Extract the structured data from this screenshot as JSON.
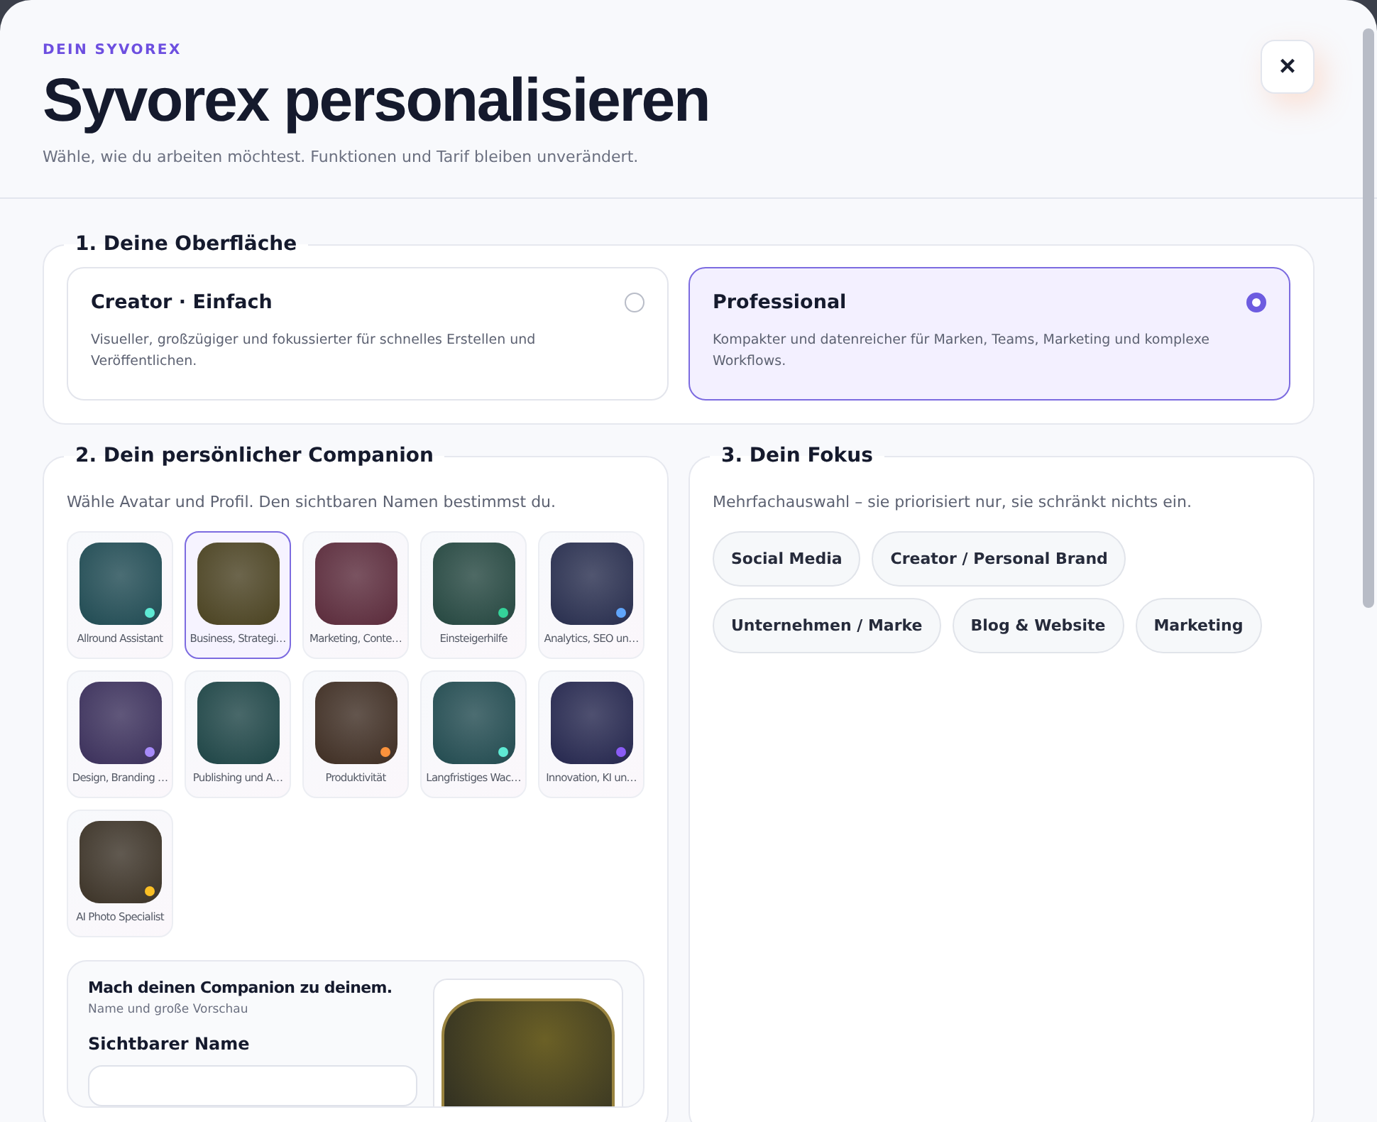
{
  "header": {
    "eyebrow": "DEIN SYVOREX",
    "title": "Syvorex personalisieren",
    "subtitle": "Wähle, wie du arbeiten möchtest. Funktionen und Tarif bleiben unverändert.",
    "close": "×"
  },
  "surface": {
    "title": "1. Deine Oberfläche",
    "options": [
      {
        "title": "Creator · Einfach",
        "description": "Visueller, großzügiger und fokussierter für schnelles Erstellen und Veröffentlichen.",
        "selected": false
      },
      {
        "title": "Professional",
        "description": "Kompakter und datenreicher für Marken, Teams, Marketing und komplexe Workflows.",
        "selected": true
      }
    ]
  },
  "companion": {
    "title": "2. Dein persönlicher Companion",
    "intro": "Wähle Avatar und Profil. Den sichtbaren Namen bestimmst du.",
    "avatars": [
      {
        "label": "Allround Assistant",
        "selected": false,
        "color": "#5eead4"
      },
      {
        "label": "Business, Strategi…",
        "selected": true
      },
      {
        "label": "Marketing, Conte…",
        "selected": false
      },
      {
        "label": "Einsteigerhilfe",
        "selected": false,
        "color": "#34d399"
      },
      {
        "label": "Analytics, SEO un…",
        "selected": false,
        "color": "#60a5fa"
      },
      {
        "label": "Design, Branding …",
        "selected": false,
        "color": "#a78bfa"
      },
      {
        "label": "Publishing und A…",
        "selected": false
      },
      {
        "label": "Produktivität",
        "selected": false,
        "color": "#fb923c"
      },
      {
        "label": "Langfristiges Wac…",
        "selected": false,
        "color": "#5eead4"
      },
      {
        "label": "Innovation, KI un…",
        "selected": false,
        "color": "#8b5cf6"
      },
      {
        "label": "AI Photo Specialist",
        "selected": false,
        "color": "#fbbf24"
      }
    ],
    "custom": {
      "title": "Mach deinen Companion zu deinem.",
      "hint": "Name und große Vorschau",
      "name_label": "Sichtbarer Name"
    }
  },
  "focus": {
    "title": "3. Dein Fokus",
    "intro": "Mehrfachauswahl – sie priorisiert nur, sie schränkt nichts ein.",
    "chips": [
      {
        "label": "Social Media",
        "selected": false
      },
      {
        "label": "Creator / Personal Brand",
        "selected": false
      },
      {
        "label": "Unternehmen / Marke",
        "selected": false
      },
      {
        "label": "Blog & Website",
        "selected": false
      },
      {
        "label": "Marketing",
        "selected": false
      }
    ]
  }
}
